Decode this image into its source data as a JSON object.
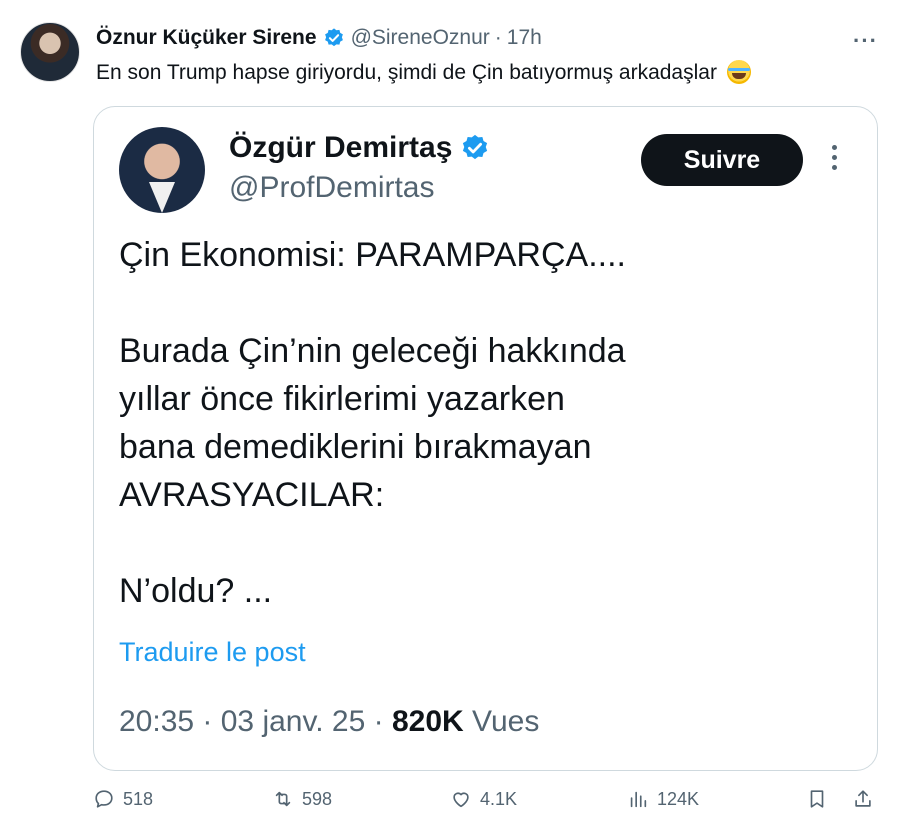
{
  "tweet": {
    "author_name": "Öznur Küçüker Sirene",
    "handle": "@SireneOznur",
    "separator": "·",
    "time": "17h",
    "text": "En son Trump hapse giriyordu, şimdi de Çin batıyormuş arkadaşlar",
    "emoji_icon": "tears-of-joy-emoji",
    "more_icon": "···"
  },
  "quote": {
    "author_name": "Özgür Demirtaş",
    "handle": "@ProfDemirtas",
    "follow_label": "Suivre",
    "lines": [
      "Çin Ekonomisi: PARAMPARÇA....",
      "Burada Çin’nin geleceği hakkında",
      "yıllar önce fikirlerimi yazarken",
      "bana demediklerini bırakmayan",
      "AVRASYACILAR:",
      "N’oldu? ..."
    ],
    "translate_label": "Traduire le post",
    "meta_time": "20:35",
    "meta_sep": " · ",
    "meta_date": "03 janv. 25",
    "views_count": "820K",
    "views_label": "Vues"
  },
  "actions": {
    "replies": "518",
    "reposts": "598",
    "likes": "4.1K",
    "views": "124K"
  },
  "colors": {
    "accent": "#1d9bf0",
    "text": "#0f1419",
    "muted": "#536471",
    "border": "#cfd9de"
  }
}
